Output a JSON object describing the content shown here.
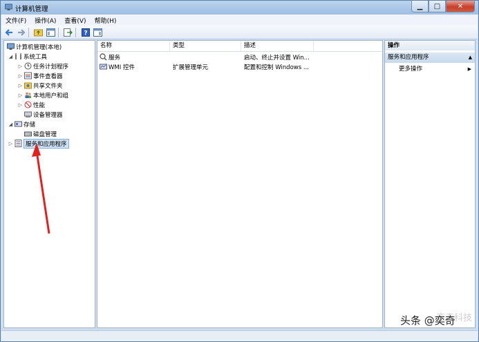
{
  "window": {
    "title": "计算机管理"
  },
  "menu": [
    "文件(F)",
    "操作(A)",
    "查看(V)",
    "帮助(H)"
  ],
  "tree": {
    "root": "计算机管理(本地)",
    "system_tools": "系统工具",
    "task_scheduler": "任务计划程序",
    "event_viewer": "事件查看器",
    "shared_folders": "共享文件夹",
    "local_users": "本地用户和组",
    "performance": "性能",
    "device_manager": "设备管理器",
    "storage": "存储",
    "disk_management": "磁盘管理",
    "services_apps": "服务和应用程序"
  },
  "list": {
    "columns": [
      "名称",
      "类型",
      "描述"
    ],
    "rows": [
      {
        "name": "服务",
        "type": "",
        "desc": "启动、终止并设置 Win..."
      },
      {
        "name": "WMI 控件",
        "type": "扩展管理单元",
        "desc": "配置和控制 Windows ..."
      }
    ]
  },
  "actions": {
    "header": "操作",
    "section": "服务和应用程序",
    "more": "更多操作"
  },
  "watermark": {
    "text": "头条 @奕奇",
    "ghost": "奕奇科技"
  }
}
